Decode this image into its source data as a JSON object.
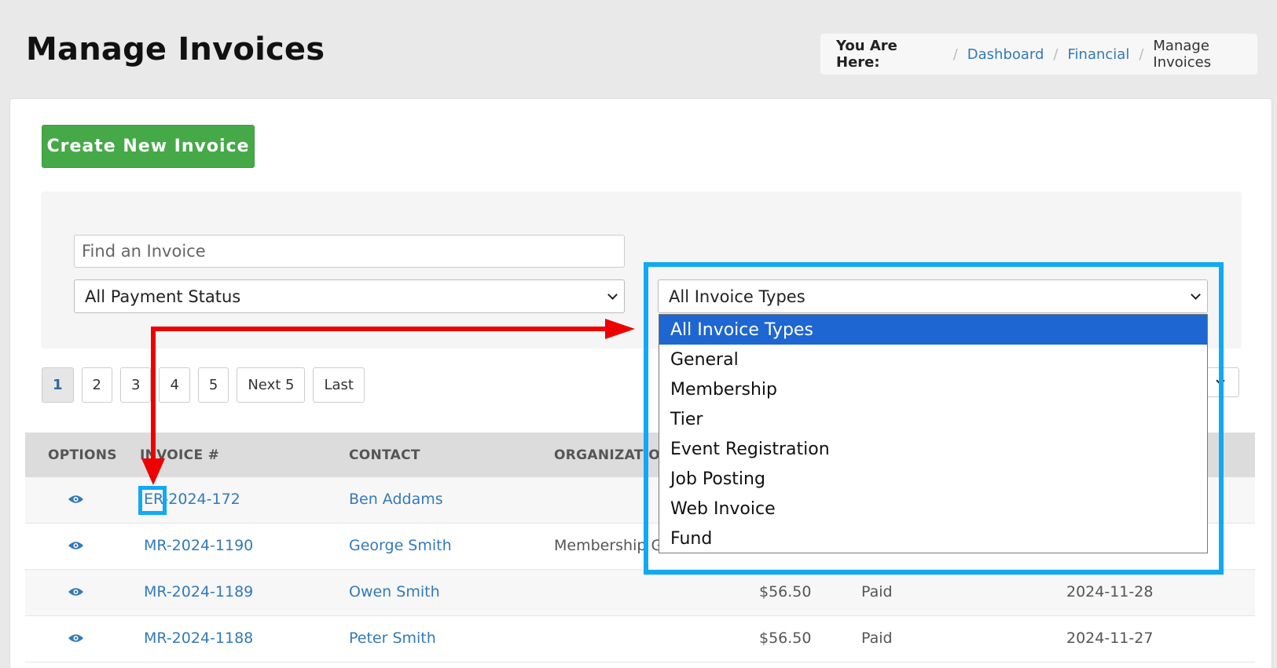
{
  "header": {
    "title": "Manage Invoices",
    "breadcrumb_lead": "You Are Here:",
    "breadcrumb_separator": "/",
    "breadcrumb": [
      "Dashboard",
      "Financial",
      "Manage Invoices"
    ]
  },
  "create_button_label": "Create New Invoice",
  "filters": {
    "search_placeholder": "Find an Invoice",
    "payment_status": "All Payment Status",
    "invoice_type": "All Invoice Types"
  },
  "pagination": [
    "1",
    "2",
    "3",
    "4",
    "5",
    "Next 5",
    "Last"
  ],
  "table": {
    "headers": [
      "OPTIONS",
      "INVOICE #",
      "CONTACT",
      "ORGANIZATION"
    ],
    "rows": [
      {
        "invoice": "ER-2024-172",
        "contact": "Ben Addams",
        "organization": "",
        "amount": "",
        "status": "",
        "date": ""
      },
      {
        "invoice": "MR-2024-1190",
        "contact": "George Smith",
        "organization": "Membership Gr",
        "amount": "",
        "status": "",
        "date": ""
      },
      {
        "invoice": "MR-2024-1189",
        "contact": "Owen Smith",
        "organization": "",
        "amount": "$56.50",
        "status": "Paid",
        "date": "2024-11-28"
      },
      {
        "invoice": "MR-2024-1188",
        "contact": "Peter Smith",
        "organization": "",
        "amount": "$56.50",
        "status": "Paid",
        "date": "2024-11-27"
      }
    ]
  },
  "invoice_type_options": [
    "All Invoice Types",
    "General",
    "Membership",
    "Tier",
    "Event Registration",
    "Job Posting",
    "Web Invoice",
    "Fund"
  ],
  "colors": {
    "accent_green": "#46a948",
    "link_blue": "#337ab7",
    "highlight_blue": "#11a9f3",
    "annotation_red": "#ee0000",
    "selected_option": "#1e66d1"
  }
}
